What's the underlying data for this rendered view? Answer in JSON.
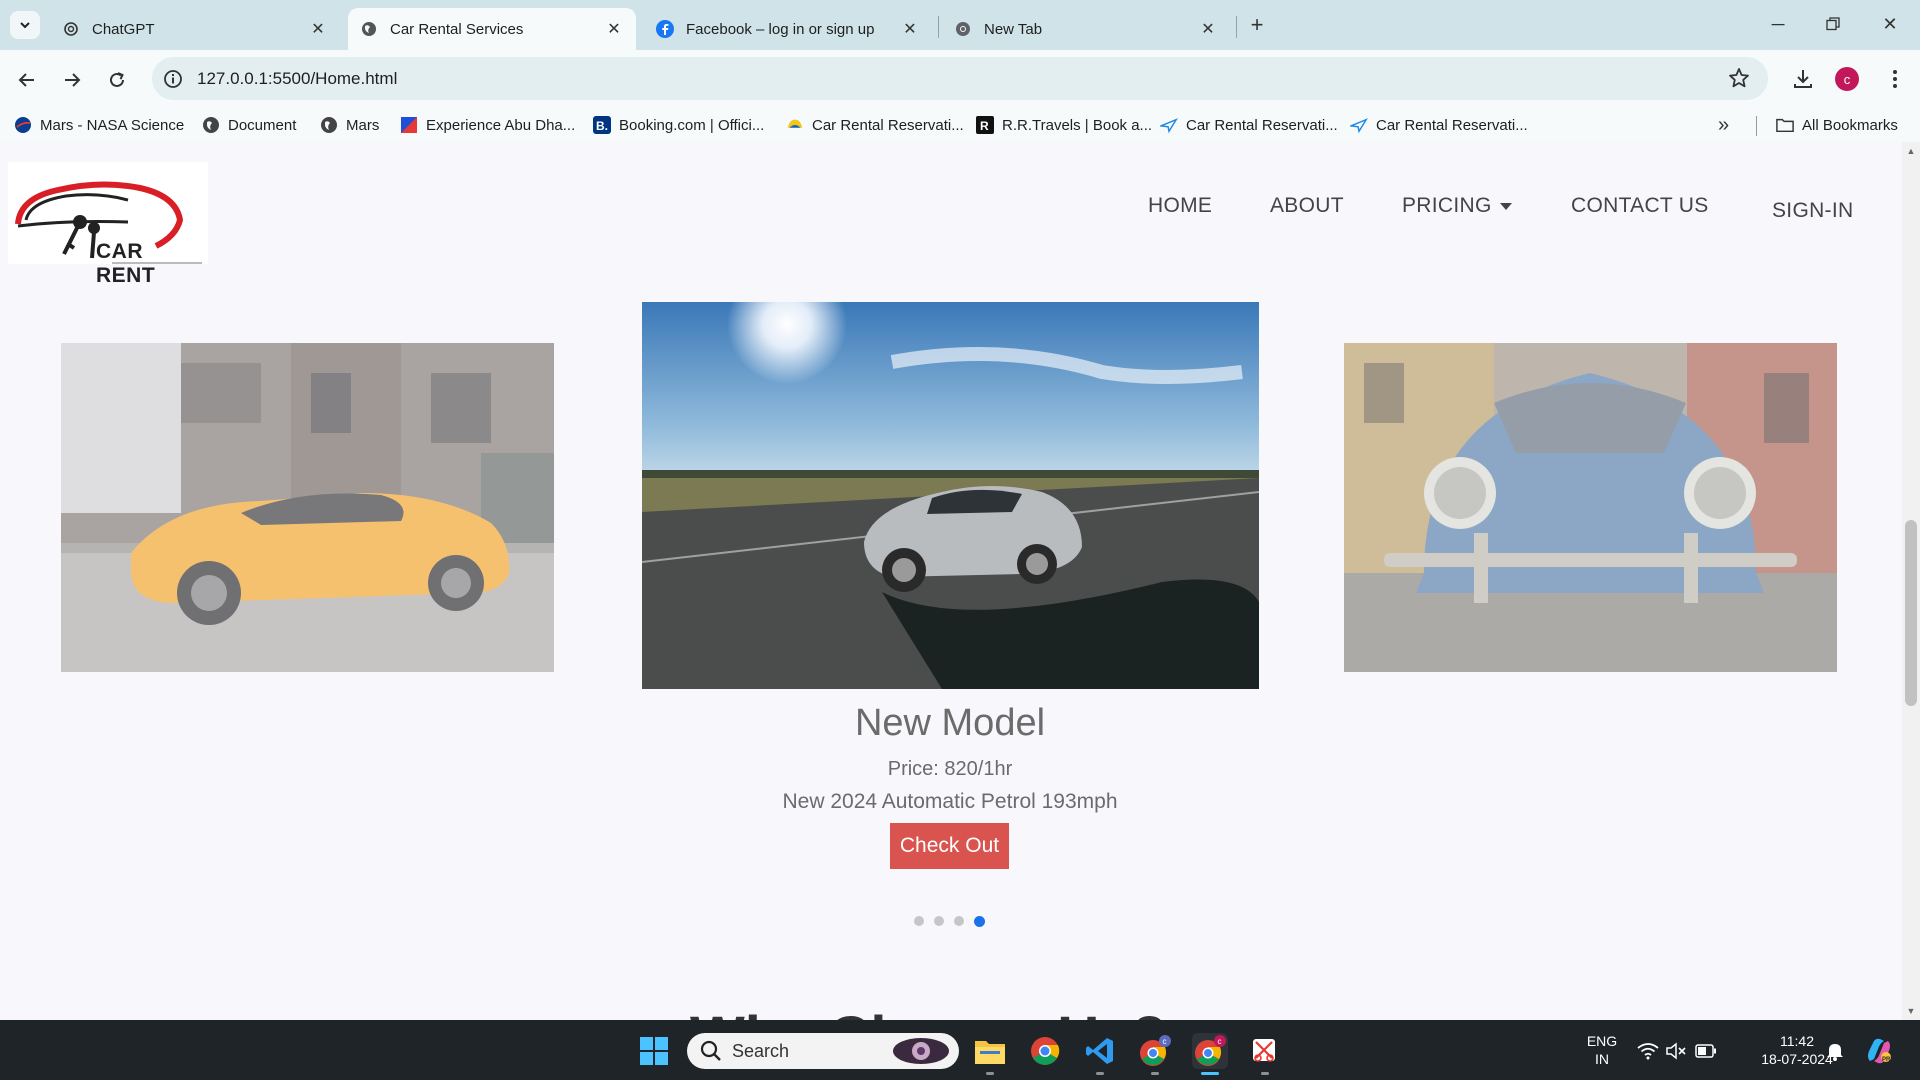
{
  "browser": {
    "tabs": [
      {
        "title": "ChatGPT",
        "favicon": "openai-icon"
      },
      {
        "title": "Car Rental Services",
        "favicon": "globe-icon",
        "active": true
      },
      {
        "title": "Facebook – log in or sign up",
        "favicon": "facebook-icon"
      },
      {
        "title": "New Tab",
        "favicon": "chrome-icon"
      }
    ],
    "url": "127.0.0.1:5500/Home.html",
    "profile_initial": "c",
    "bookmarks": [
      {
        "label": "Mars - NASA Science",
        "icon": "nasa-icon"
      },
      {
        "label": "Document",
        "icon": "globe-icon"
      },
      {
        "label": "Mars",
        "icon": "globe-icon"
      },
      {
        "label": "Experience Abu Dha...",
        "icon": "abu-dhabi-icon"
      },
      {
        "label": "Booking.com | Offici...",
        "icon": "booking-icon"
      },
      {
        "label": "Car Rental Reservati...",
        "icon": "car-rental-icon"
      },
      {
        "label": "R.R.Travels | Book a...",
        "icon": "rr-travels-icon"
      },
      {
        "label": "Car Rental Reservati...",
        "icon": "plane-icon"
      },
      {
        "label": "Car Rental Reservati...",
        "icon": "plane-icon"
      }
    ],
    "all_bookmarks_label": "All Bookmarks"
  },
  "site": {
    "logo_text": "CAR RENT",
    "nav": {
      "home": "HOME",
      "about": "ABOUT",
      "pricing": "PRICING",
      "contact": "CONTACT US",
      "signin": "SIGN-IN"
    },
    "carousel": {
      "title": "New Model",
      "price": "Price: 820/1hr",
      "description": "New 2024 Automatic Petrol 193mph",
      "button": "Check Out",
      "total_slides": 4,
      "active_slide": 4
    },
    "next_heading_peek": "Why Choose Us?"
  },
  "taskbar": {
    "search_label": "Search",
    "lang_top": "ENG",
    "lang_bottom": "IN",
    "time": "11:42",
    "date": "18-07-2024"
  },
  "colors": {
    "checkout_button": "#d9534f",
    "active_dot": "#1a73e8",
    "tab_strip": "#cfe3e8"
  }
}
